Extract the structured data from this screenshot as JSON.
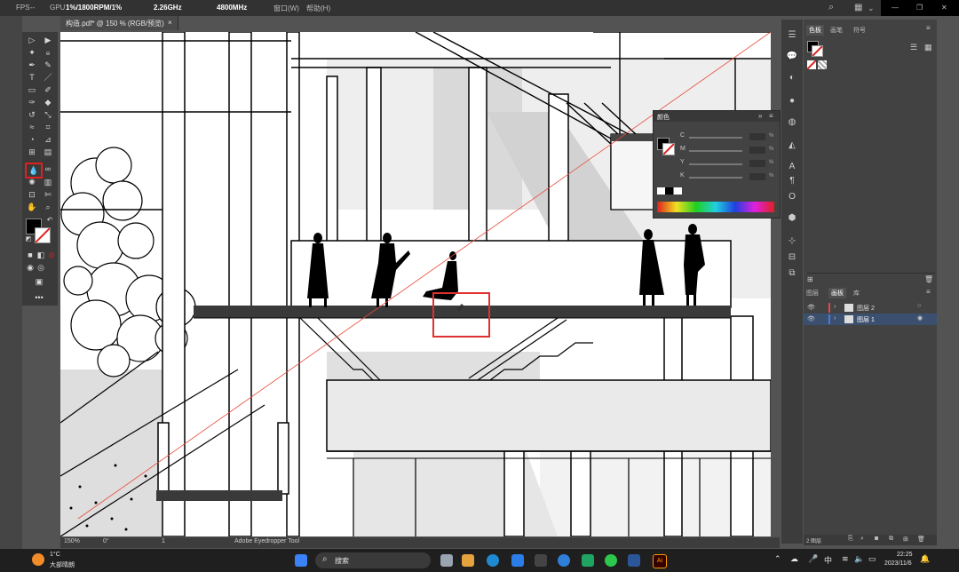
{
  "menubar": {
    "fps_label": "FPS",
    "fps_value": "--",
    "gpu_label": "GPU",
    "gpu_value": "1%/1800RPM/1%",
    "cpu_freq": "2.26GHz",
    "ram_freq": "4800MHz",
    "menu_window": "窗口(W)",
    "menu_help": "帮助(H)"
  },
  "document": {
    "tab_title": "构造.pdf* @ 150 % (RGB/预览)",
    "close_glyph": "×"
  },
  "status": {
    "zoom": "150%",
    "rotation": "0°",
    "artboard": "1",
    "tool_name": "Adobe Eyedropper Tool"
  },
  "panels": {
    "top_tabs": [
      "色板",
      "画笔",
      "符号"
    ],
    "color_panel_title": "颜色",
    "color_channels": [
      "C",
      "M",
      "Y",
      "K"
    ],
    "color_pct": "%",
    "layers_tabs": [
      "图层",
      "画板",
      "库"
    ],
    "layers": [
      {
        "name": "图层 2",
        "color": "#e04c4c"
      },
      {
        "name": "图层 1",
        "color": "#4b7bd8"
      }
    ],
    "layers_count": "2 图层"
  },
  "taskbar": {
    "weather_temp": "1°C",
    "weather_desc": "大部晴朗",
    "search_placeholder": "搜索",
    "ime": "中",
    "time": "22:25",
    "date": "2023/11/6"
  },
  "colors": {
    "accent_red": "#e02020",
    "highlight_box": "#e03030"
  }
}
